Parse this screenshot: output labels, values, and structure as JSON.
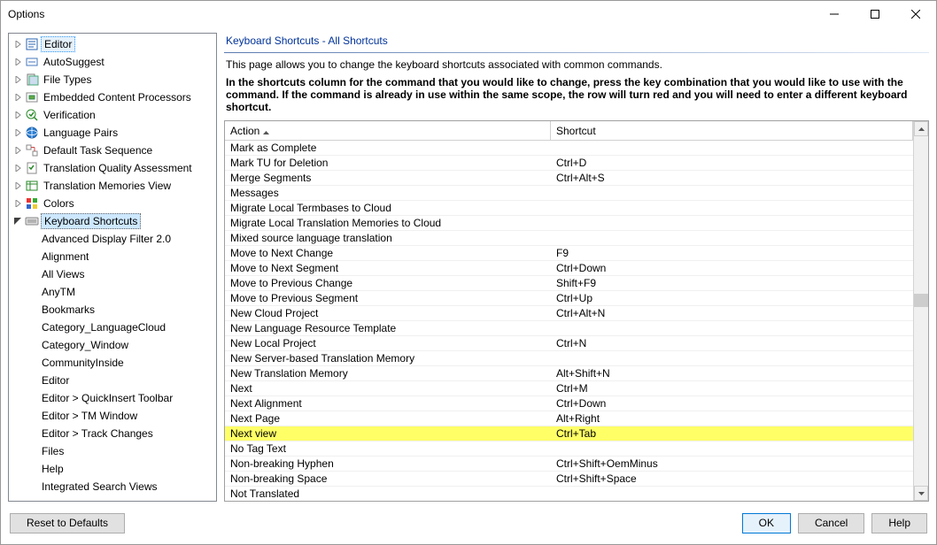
{
  "window_title": "Options",
  "tree": {
    "items": [
      {
        "label": "Editor",
        "icon": "editor",
        "exp": 1,
        "sel": "edit"
      },
      {
        "label": "AutoSuggest",
        "icon": "autosuggest",
        "exp": 1
      },
      {
        "label": "File Types",
        "icon": "filetypes",
        "exp": 1
      },
      {
        "label": "Embedded Content Processors",
        "icon": "embedded",
        "exp": 1
      },
      {
        "label": "Verification",
        "icon": "verification",
        "exp": 1
      },
      {
        "label": "Language Pairs",
        "icon": "langpairs",
        "exp": 1
      },
      {
        "label": "Default Task Sequence",
        "icon": "tasksequence",
        "exp": 1
      },
      {
        "label": "Translation Quality Assessment",
        "icon": "tqa",
        "exp": 1
      },
      {
        "label": "Translation Memories View",
        "icon": "tmview",
        "exp": 1
      },
      {
        "label": "Colors",
        "icon": "colors",
        "exp": 1
      },
      {
        "label": "Keyboard Shortcuts",
        "icon": "keyboard",
        "exp": 2,
        "sel": "kb"
      }
    ],
    "children": [
      "Advanced Display Filter 2.0",
      "Alignment",
      "All Views",
      "AnyTM",
      "Bookmarks",
      "Category_LanguageCloud",
      "Category_Window",
      "CommunityInside",
      "Editor",
      "Editor > QuickInsert Toolbar",
      "Editor > TM Window",
      "Editor > Track Changes",
      "Files",
      "Help",
      "Integrated Search Views"
    ]
  },
  "heading": "Keyboard Shortcuts - All Shortcuts",
  "desc": "This page allows you to change the keyboard shortcuts associated with common commands.",
  "instr": "In the shortcuts column for the command that you would like to change, press the key combination that you would like to use with the command.  If the command is already in use within the same scope, the row will turn red and you will need to enter a different keyboard shortcut.",
  "grid": {
    "col_action": "Action",
    "col_shortcut": "Shortcut",
    "rows": [
      {
        "a": "Mark as Complete",
        "s": ""
      },
      {
        "a": "Mark TU for Deletion",
        "s": "Ctrl+D"
      },
      {
        "a": "Merge Segments",
        "s": "Ctrl+Alt+S"
      },
      {
        "a": "Messages",
        "s": ""
      },
      {
        "a": "Migrate Local Termbases to Cloud",
        "s": ""
      },
      {
        "a": "Migrate Local Translation Memories to Cloud",
        "s": ""
      },
      {
        "a": "Mixed source language translation",
        "s": ""
      },
      {
        "a": "Move to Next Change",
        "s": "F9"
      },
      {
        "a": "Move to Next Segment",
        "s": "Ctrl+Down"
      },
      {
        "a": "Move to Previous Change",
        "s": "Shift+F9"
      },
      {
        "a": "Move to Previous Segment",
        "s": "Ctrl+Up"
      },
      {
        "a": "New Cloud Project",
        "s": "Ctrl+Alt+N"
      },
      {
        "a": "New Language Resource Template",
        "s": ""
      },
      {
        "a": "New Local Project",
        "s": "Ctrl+N"
      },
      {
        "a": "New Server-based Translation Memory",
        "s": ""
      },
      {
        "a": "New Translation Memory",
        "s": "Alt+Shift+N"
      },
      {
        "a": "Next",
        "s": "Ctrl+M"
      },
      {
        "a": "Next Alignment",
        "s": "Ctrl+Down"
      },
      {
        "a": "Next Page",
        "s": "Alt+Right"
      },
      {
        "a": "Next view",
        "s": "Ctrl+Tab",
        "hl": 1
      },
      {
        "a": "No Tag Text",
        "s": ""
      },
      {
        "a": "Non-breaking Hyphen",
        "s": "Ctrl+Shift+OemMinus"
      },
      {
        "a": "Non-breaking Space",
        "s": "Ctrl+Shift+Space"
      },
      {
        "a": "Not Translated",
        "s": ""
      }
    ]
  },
  "buttons": {
    "reset": "Reset to Defaults",
    "ok": "OK",
    "cancel": "Cancel",
    "help": "Help"
  }
}
